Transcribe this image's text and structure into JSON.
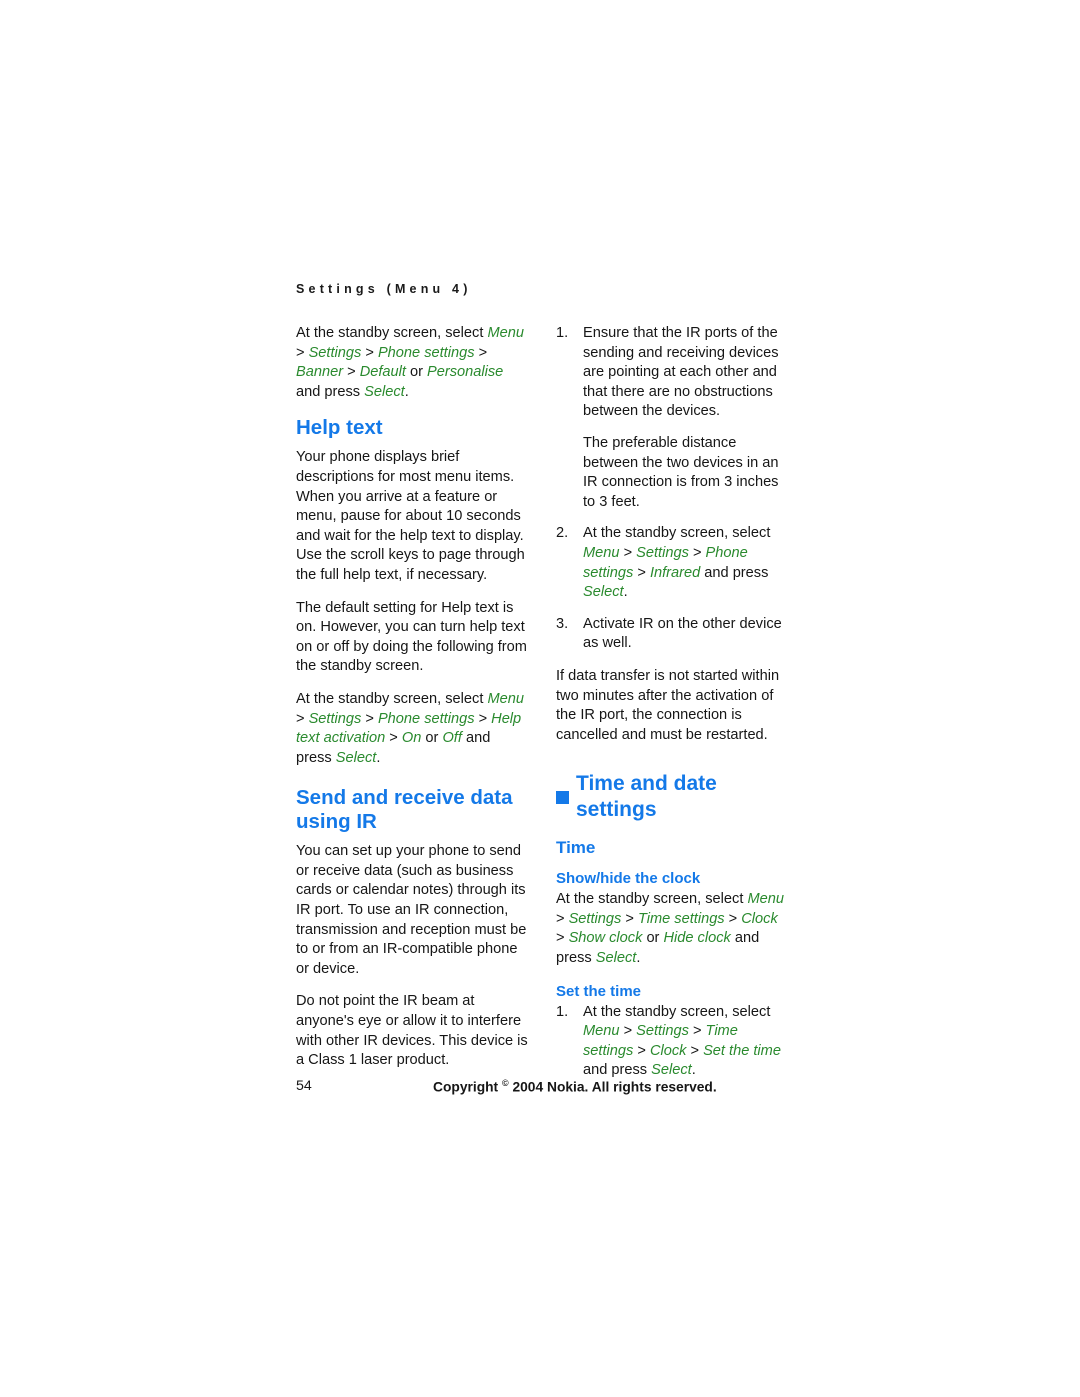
{
  "page": {
    "running_head": "Settings (Menu 4)",
    "page_number": "54",
    "copyright_prefix": "Copyright ",
    "copyright_symbol": "©",
    "copyright_suffix": " 2004 Nokia. All rights reserved."
  },
  "colors": {
    "heading_blue": "#1479e8",
    "menu_green": "#2a8a2e",
    "body_black": "#161616",
    "page_background": "#ffffff"
  },
  "left_column": {
    "intro_paragraph": {
      "lead": "At the standby screen, select ",
      "path": [
        {
          "text": "Menu",
          "style": "menu"
        },
        {
          "text": " > ",
          "style": "sep"
        },
        {
          "text": "Settings",
          "style": "menu"
        },
        {
          "text": " > ",
          "style": "sep"
        },
        {
          "text": "Phone settings",
          "style": "menu"
        },
        {
          "text": " > ",
          "style": "sep"
        },
        {
          "text": "Banner",
          "style": "menu"
        },
        {
          "text": " > ",
          "style": "sep"
        },
        {
          "text": "Default",
          "style": "menu"
        },
        {
          "text": " or ",
          "style": "plain"
        },
        {
          "text": "Personalise",
          "style": "menu"
        },
        {
          "text": " and press ",
          "style": "plain"
        },
        {
          "text": "Select",
          "style": "menu"
        },
        {
          "text": ".",
          "style": "plain"
        }
      ]
    },
    "help_text_heading": "Help text",
    "help_text_para_1": "Your phone displays brief descriptions for most menu items. When you arrive at a feature or menu, pause for about 10 seconds and wait for the help text to display. Use the scroll keys to page through the full help text, if necessary.",
    "help_text_para_2": "The default setting for Help text is on. However, you can turn help text on or off by doing the following from the standby screen.",
    "help_text_path": {
      "lead": "At the standby screen, select ",
      "path": [
        {
          "text": "Menu",
          "style": "menu"
        },
        {
          "text": " > ",
          "style": "sep"
        },
        {
          "text": "Settings",
          "style": "menu"
        },
        {
          "text": " > ",
          "style": "sep"
        },
        {
          "text": "Phone settings",
          "style": "menu"
        },
        {
          "text": " > ",
          "style": "sep"
        },
        {
          "text": "Help text activation",
          "style": "menu"
        },
        {
          "text": " > ",
          "style": "sep"
        },
        {
          "text": "On",
          "style": "menu"
        },
        {
          "text": " or ",
          "style": "plain"
        },
        {
          "text": "Off",
          "style": "menu"
        },
        {
          "text": " and press ",
          "style": "plain"
        },
        {
          "text": "Select",
          "style": "menu"
        },
        {
          "text": ".",
          "style": "plain"
        }
      ]
    },
    "ir_heading": "Send and receive data using IR",
    "ir_para_1": "You can set up your phone to send or receive data (such as business cards or calendar notes) through its IR port. To use an IR connection, transmission and reception must be to or from an IR-compatible phone or device.",
    "ir_para_2": "Do not point the IR beam at anyone's eye or allow it to interfere with other IR devices. This device is a Class 1 laser product."
  },
  "right_column": {
    "steps": [
      {
        "marker": "1.",
        "text": "Ensure that the IR ports of the sending and receiving devices are pointing at each other and that there are no obstructions between the devices.",
        "sub_para": "The preferable distance between the two devices in an IR connection is from 3 inches to 3 feet."
      },
      {
        "marker": "2.",
        "lead": "At the standby screen, select ",
        "path": [
          {
            "text": "Menu",
            "style": "menu"
          },
          {
            "text": " > ",
            "style": "sep"
          },
          {
            "text": "Settings",
            "style": "menu"
          },
          {
            "text": " > ",
            "style": "sep"
          },
          {
            "text": "Phone settings",
            "style": "menu"
          },
          {
            "text": " > ",
            "style": "sep"
          },
          {
            "text": "Infrared",
            "style": "menu"
          },
          {
            "text": " and press ",
            "style": "plain"
          },
          {
            "text": "Select",
            "style": "menu"
          },
          {
            "text": ".",
            "style": "plain"
          }
        ]
      },
      {
        "marker": "3.",
        "text": "Activate IR on the other device as well."
      }
    ],
    "ir_note": "If data transfer is not started within two minutes after the activation of the IR port, the connection is cancelled and must be restarted.",
    "time_date_heading": "Time and date settings",
    "time_heading": "Time",
    "show_hide_heading": "Show/hide the clock",
    "show_hide_path": {
      "lead": "At the standby screen, select ",
      "path": [
        {
          "text": "Menu",
          "style": "menu"
        },
        {
          "text": " > ",
          "style": "sep"
        },
        {
          "text": "Settings",
          "style": "menu"
        },
        {
          "text": " > ",
          "style": "sep"
        },
        {
          "text": "Time settings",
          "style": "menu"
        },
        {
          "text": " > ",
          "style": "sep"
        },
        {
          "text": "Clock",
          "style": "menu"
        },
        {
          "text": " > ",
          "style": "sep"
        },
        {
          "text": "Show clock",
          "style": "menu"
        },
        {
          "text": " or ",
          "style": "plain"
        },
        {
          "text": "Hide clock",
          "style": "menu"
        },
        {
          "text": " and press ",
          "style": "plain"
        },
        {
          "text": "Select",
          "style": "menu"
        },
        {
          "text": ".",
          "style": "plain"
        }
      ]
    },
    "set_time_heading": "Set the time",
    "set_time_step": {
      "marker": "1.",
      "lead": "At the standby screen, select ",
      "path": [
        {
          "text": "Menu",
          "style": "menu"
        },
        {
          "text": " > ",
          "style": "sep"
        },
        {
          "text": "Settings",
          "style": "menu"
        },
        {
          "text": " > ",
          "style": "sep"
        },
        {
          "text": "Time settings",
          "style": "menu"
        },
        {
          "text": " > ",
          "style": "sep"
        },
        {
          "text": "Clock",
          "style": "menu"
        },
        {
          "text": " > ",
          "style": "sep"
        },
        {
          "text": "Set the time",
          "style": "menu"
        },
        {
          "text": " and press ",
          "style": "plain"
        },
        {
          "text": "Select",
          "style": "menu"
        },
        {
          "text": ".",
          "style": "plain"
        }
      ]
    }
  }
}
